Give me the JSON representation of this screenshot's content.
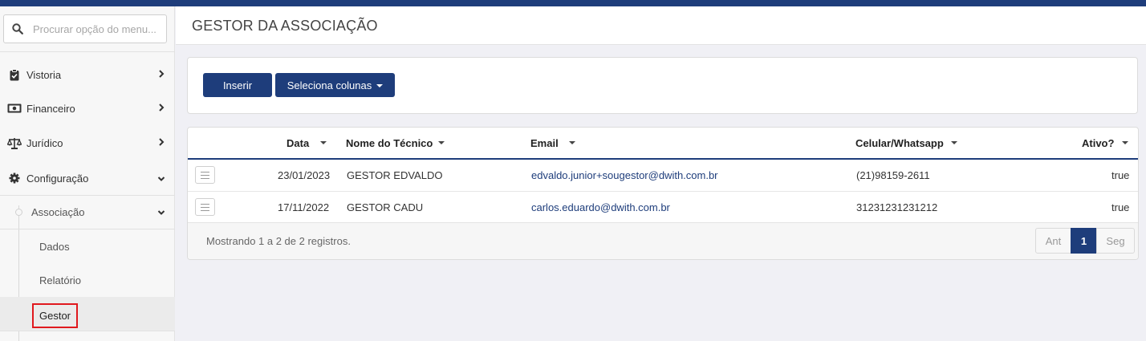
{
  "app": {
    "accent": "#1e3d7b",
    "highlight": "#e0191e"
  },
  "search": {
    "placeholder": "Procurar opção do menu..."
  },
  "sidebar": {
    "items": [
      {
        "label": "Vistoria",
        "icon": "clipboard-icon"
      },
      {
        "label": "Financeiro",
        "icon": "money-icon"
      },
      {
        "label": "Jurídico",
        "icon": "scale-icon"
      },
      {
        "label": "Configuração",
        "icon": "gear-icon"
      }
    ],
    "submenu": {
      "label": "Associação",
      "items": [
        "Dados",
        "Relatório",
        "Gestor"
      ]
    }
  },
  "page": {
    "title": "GESTOR DA ASSOCIAÇÃO"
  },
  "toolbar": {
    "insert_label": "Inserir",
    "columns_label": "Seleciona colunas"
  },
  "table": {
    "columns": [
      "Data",
      "Nome do Técnico",
      "Email",
      "Celular/Whatsapp",
      "Ativo?"
    ],
    "rows": [
      {
        "data": "23/01/2023",
        "nome": "GESTOR EDVALDO",
        "email": "edvaldo.junior+sougestor@dwith.com.br",
        "celular": "(21)98159-2611",
        "ativo": "true"
      },
      {
        "data": "17/11/2022",
        "nome": "GESTOR CADU",
        "email": "carlos.eduardo@dwith.com.br",
        "celular": "31231231231212",
        "ativo": "true"
      }
    ],
    "footer_text": "Mostrando 1 a 2 de 2 registros.",
    "pagination": {
      "prev": "Ant",
      "current": "1",
      "next": "Seg"
    }
  }
}
